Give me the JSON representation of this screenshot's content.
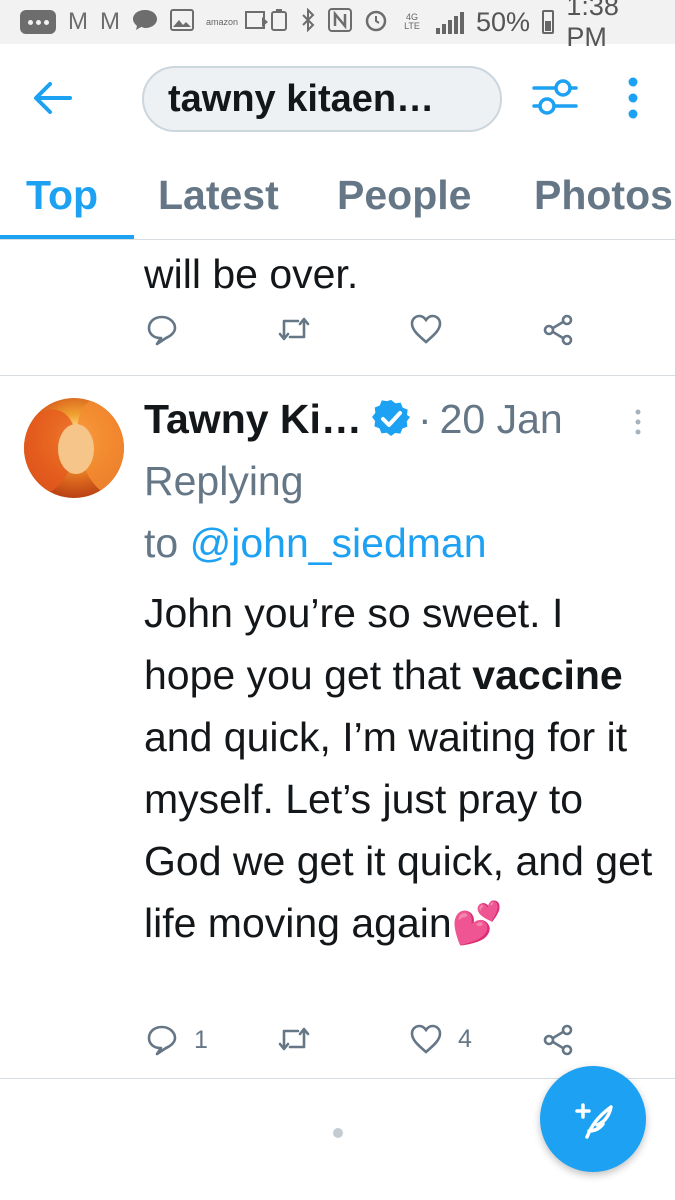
{
  "status_bar": {
    "amazon_label": "amazon",
    "network_label": "4G LTE",
    "battery_percent": "50%",
    "time": "1:38 PM"
  },
  "header": {
    "search_value": "tawny kitaen…"
  },
  "tabs": [
    {
      "label": "Top",
      "active": true
    },
    {
      "label": "Latest",
      "active": false
    },
    {
      "label": "People",
      "active": false
    },
    {
      "label": "Photos",
      "active": false
    }
  ],
  "previous_tweet": {
    "tail_text": "will be over."
  },
  "tweet": {
    "author_name": "Tawny Ki…",
    "separator": "·",
    "date": "20 Jan",
    "replying_label": "Replying",
    "to_label": "to",
    "mention": "@john_siedman",
    "text_part1": "John you’re so sweet. I hope you get that",
    "text_bold": "vaccine",
    "text_part2": "and quick, I’m waiting for it myself. Let’s just pray to God we get it quick, and get life moving again💕",
    "reply_count": "1",
    "like_count": "4"
  },
  "colors": {
    "accent": "#1da1f2",
    "muted_text": "#657786",
    "primary_text": "#14171a"
  }
}
